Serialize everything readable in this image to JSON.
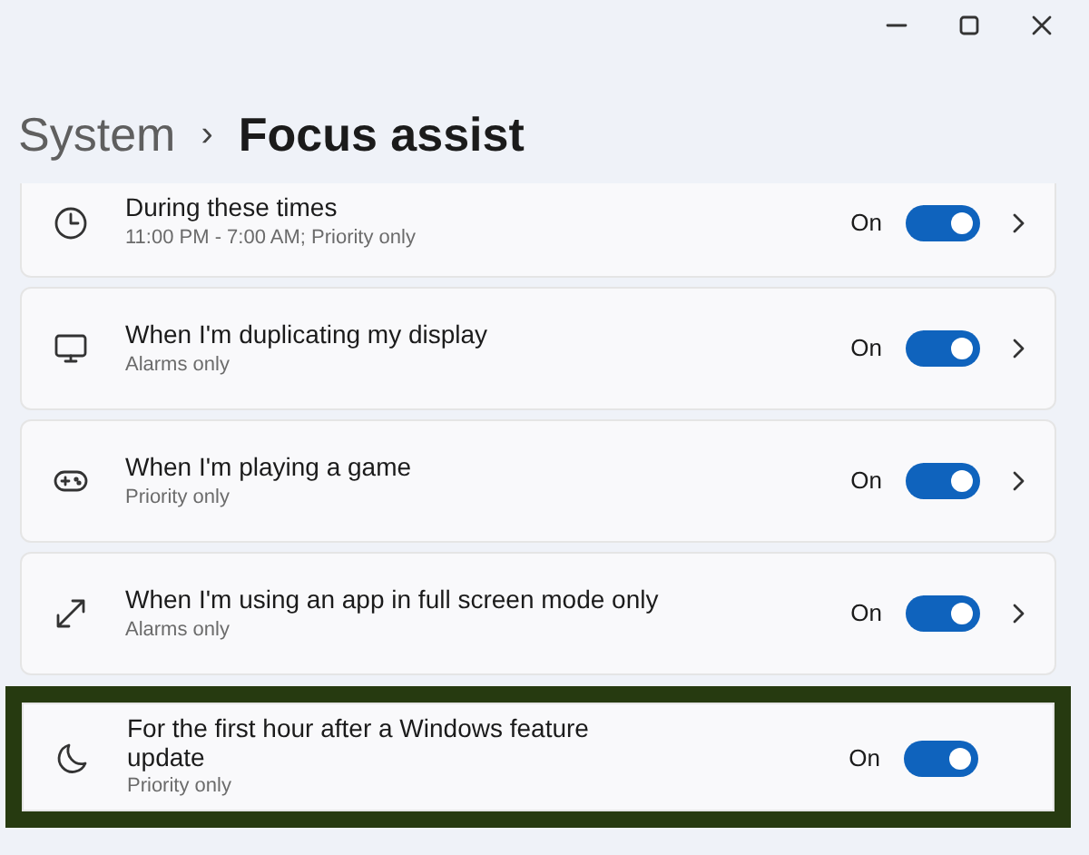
{
  "window": {
    "controls": [
      {
        "kind": "minimize"
      },
      {
        "kind": "maximize"
      },
      {
        "kind": "close"
      }
    ]
  },
  "breadcrumb": {
    "parent": "System",
    "separator": "›",
    "current": "Focus assist"
  },
  "rules": [
    {
      "kind": "clock",
      "title": "During these times",
      "subtitle": "11:00 PM - 7:00 AM; Priority only",
      "state_label": "On",
      "on": true,
      "chevron": true,
      "highlighted": false
    },
    {
      "kind": "monitor",
      "title": "When I'm duplicating my display",
      "subtitle": "Alarms only",
      "state_label": "On",
      "on": true,
      "chevron": true,
      "highlighted": false
    },
    {
      "kind": "gamepad",
      "title": "When I'm playing a game",
      "subtitle": "Priority only",
      "state_label": "On",
      "on": true,
      "chevron": true,
      "highlighted": false
    },
    {
      "kind": "expand",
      "title": "When I'm using an app in full screen mode only",
      "subtitle": "Alarms only",
      "state_label": "On",
      "on": true,
      "chevron": true,
      "highlighted": false
    },
    {
      "kind": "moon",
      "title": "For the first hour after a Windows feature update",
      "subtitle": "Priority only",
      "state_label": "On",
      "on": true,
      "chevron": false,
      "highlighted": true
    }
  ]
}
